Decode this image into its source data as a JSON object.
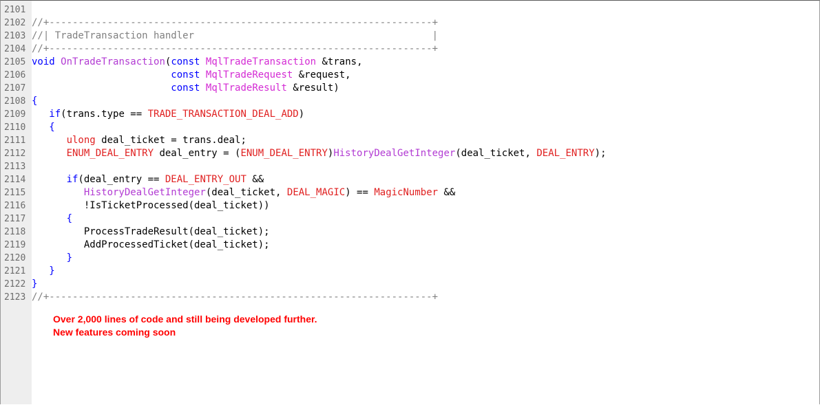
{
  "editor": {
    "lines": [
      {
        "n": "2101",
        "tokens": []
      },
      {
        "n": "2102",
        "tokens": [
          {
            "t": "//+------------------------------------------------------------------+",
            "c": "comment"
          }
        ]
      },
      {
        "n": "2103",
        "tokens": [
          {
            "t": "//| TradeTransaction handler                                         |",
            "c": "comment"
          }
        ]
      },
      {
        "n": "2104",
        "tokens": [
          {
            "t": "//+------------------------------------------------------------------+",
            "c": "comment"
          }
        ]
      },
      {
        "n": "2105",
        "tokens": [
          {
            "t": "void",
            "c": "kw"
          },
          {
            "t": " ",
            "c": "plain"
          },
          {
            "t": "OnTradeTransaction",
            "c": "fn"
          },
          {
            "t": "(",
            "c": "plain"
          },
          {
            "t": "const",
            "c": "kw"
          },
          {
            "t": " ",
            "c": "plain"
          },
          {
            "t": "MqlTradeTransaction",
            "c": "type"
          },
          {
            "t": " &trans,",
            "c": "plain"
          }
        ]
      },
      {
        "n": "2106",
        "tokens": [
          {
            "t": "                        ",
            "c": "plain"
          },
          {
            "t": "const",
            "c": "kw"
          },
          {
            "t": " ",
            "c": "plain"
          },
          {
            "t": "MqlTradeRequest",
            "c": "type"
          },
          {
            "t": " &request,",
            "c": "plain"
          }
        ]
      },
      {
        "n": "2107",
        "tokens": [
          {
            "t": "                        ",
            "c": "plain"
          },
          {
            "t": "const",
            "c": "kw"
          },
          {
            "t": " ",
            "c": "plain"
          },
          {
            "t": "MqlTradeResult",
            "c": "type"
          },
          {
            "t": " &result)",
            "c": "plain"
          }
        ]
      },
      {
        "n": "2108",
        "tokens": [
          {
            "t": "{",
            "c": "kw"
          }
        ]
      },
      {
        "n": "2109",
        "tokens": [
          {
            "t": "   ",
            "c": "plain"
          },
          {
            "t": "if",
            "c": "kw"
          },
          {
            "t": "(trans.type == ",
            "c": "plain"
          },
          {
            "t": "TRADE_TRANSACTION_DEAL_ADD",
            "c": "const"
          },
          {
            "t": ")",
            "c": "plain"
          }
        ]
      },
      {
        "n": "2110",
        "tokens": [
          {
            "t": "   ",
            "c": "plain"
          },
          {
            "t": "{",
            "c": "kw"
          }
        ]
      },
      {
        "n": "2111",
        "tokens": [
          {
            "t": "      ",
            "c": "plain"
          },
          {
            "t": "ulong",
            "c": "const"
          },
          {
            "t": " deal_ticket = trans.deal;",
            "c": "plain"
          }
        ]
      },
      {
        "n": "2112",
        "tokens": [
          {
            "t": "      ",
            "c": "plain"
          },
          {
            "t": "ENUM_DEAL_ENTRY",
            "c": "const"
          },
          {
            "t": " deal_entry = (",
            "c": "plain"
          },
          {
            "t": "ENUM_DEAL_ENTRY",
            "c": "const"
          },
          {
            "t": ")",
            "c": "plain"
          },
          {
            "t": "HistoryDealGetInteger",
            "c": "fn"
          },
          {
            "t": "(deal_ticket, ",
            "c": "plain"
          },
          {
            "t": "DEAL_ENTRY",
            "c": "const"
          },
          {
            "t": ");",
            "c": "plain"
          }
        ]
      },
      {
        "n": "2113",
        "tokens": []
      },
      {
        "n": "2114",
        "tokens": [
          {
            "t": "      ",
            "c": "plain"
          },
          {
            "t": "if",
            "c": "kw"
          },
          {
            "t": "(deal_entry == ",
            "c": "plain"
          },
          {
            "t": "DEAL_ENTRY_OUT",
            "c": "const"
          },
          {
            "t": " &&",
            "c": "plain"
          }
        ]
      },
      {
        "n": "2115",
        "tokens": [
          {
            "t": "         ",
            "c": "plain"
          },
          {
            "t": "HistoryDealGetInteger",
            "c": "fn"
          },
          {
            "t": "(deal_ticket, ",
            "c": "plain"
          },
          {
            "t": "DEAL_MAGIC",
            "c": "const"
          },
          {
            "t": ") == ",
            "c": "plain"
          },
          {
            "t": "MagicNumber",
            "c": "const"
          },
          {
            "t": " &&",
            "c": "plain"
          }
        ]
      },
      {
        "n": "2116",
        "tokens": [
          {
            "t": "         ",
            "c": "plain"
          },
          {
            "t": "!IsTicketProcessed(deal_ticket))",
            "c": "plain"
          }
        ]
      },
      {
        "n": "2117",
        "tokens": [
          {
            "t": "      ",
            "c": "plain"
          },
          {
            "t": "{",
            "c": "kw"
          }
        ]
      },
      {
        "n": "2118",
        "tokens": [
          {
            "t": "         ProcessTradeResult(deal_ticket);",
            "c": "plain"
          }
        ]
      },
      {
        "n": "2119",
        "tokens": [
          {
            "t": "         AddProcessedTicket(deal_ticket);",
            "c": "plain"
          }
        ]
      },
      {
        "n": "2120",
        "tokens": [
          {
            "t": "      ",
            "c": "plain"
          },
          {
            "t": "}",
            "c": "kw"
          }
        ]
      },
      {
        "n": "2121",
        "tokens": [
          {
            "t": "   ",
            "c": "plain"
          },
          {
            "t": "}",
            "c": "kw"
          }
        ]
      },
      {
        "n": "2122",
        "tokens": [
          {
            "t": "}",
            "c": "kw"
          }
        ]
      },
      {
        "n": "2123",
        "tokens": [
          {
            "t": "//+------------------------------------------------------------------+",
            "c": "comment"
          }
        ]
      }
    ]
  },
  "promo": {
    "line1": "Over 2,000 lines of code and still being developed further.",
    "line2": "New features coming soon"
  },
  "colors": {
    "gutter": "#eeeeee",
    "line_number": "#6b6b6b",
    "comment": "#808080",
    "keyword": "#0000ff",
    "type": "#d42bd4",
    "function": "#b23bd3",
    "constant": "#e02020",
    "promo": "#ff0000"
  }
}
